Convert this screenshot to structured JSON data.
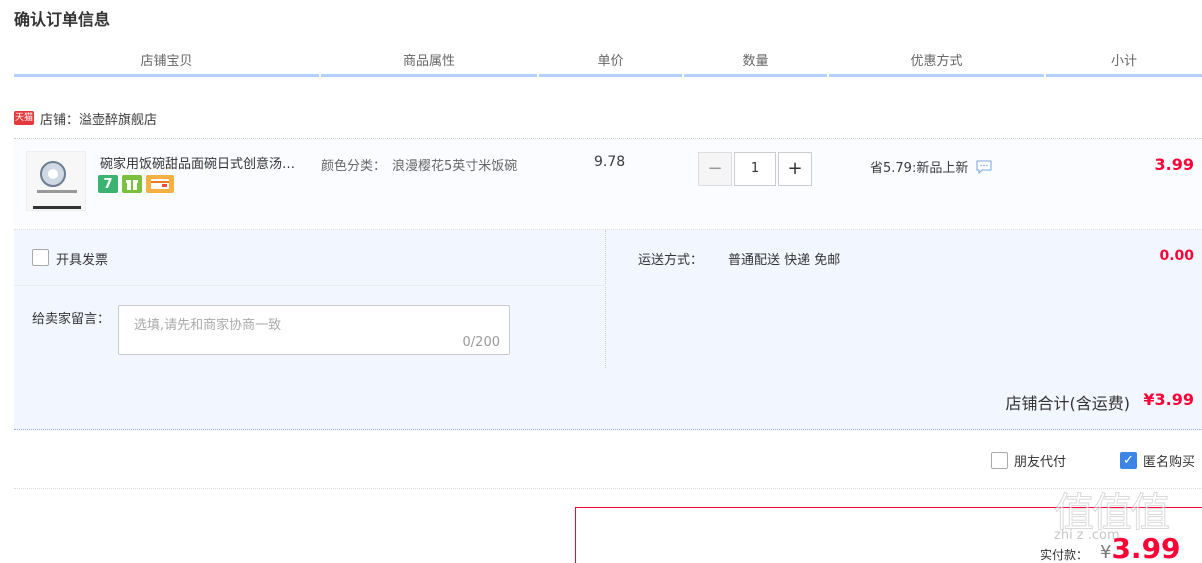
{
  "page": {
    "title": "确认订单信息"
  },
  "columns": [
    "店铺宝贝",
    "商品属性",
    "单价",
    "数量",
    "优惠方式",
    "小计"
  ],
  "shop": {
    "badge": "天猫",
    "label": "店铺：溢壶醉旗舰店"
  },
  "item": {
    "title": "碗家用饭碗甜品面碗日式创意汤…",
    "attr_name": "颜色分类：",
    "attr_value": "浪漫樱花5英寸米饭碗",
    "price": "9.78",
    "quantity": "1",
    "qty_minus": "−",
    "qty_plus": "+",
    "discount": "省5.79:新品上新",
    "subtotal": "3.99",
    "services": [
      "7",
      "gift-icon",
      "card-icon"
    ]
  },
  "invoice": {
    "label": "开具发票"
  },
  "message": {
    "label": "给卖家留言：",
    "placeholder": "选填,请先和商家协商一致",
    "counter": "0/200"
  },
  "shipping": {
    "label": "运送方式：",
    "value": "普通配送 快递 免邮",
    "cost": "0.00"
  },
  "shop_total": {
    "label": "店铺合计(含运费)",
    "amount": "¥3.99"
  },
  "options": {
    "friend_pay": "朋友代付",
    "anonymous": "匿名购买",
    "anonymous_checked": true
  },
  "payment": {
    "label": "实付款：",
    "currency": "¥",
    "amount": "3.99"
  },
  "watermark": {
    "glyphs": "值值值",
    "site": "zhi  z  .com"
  },
  "colors": {
    "accent": "#ff0036",
    "header_line": "#b2d1ff",
    "panel": "#f2f7ff",
    "check": "#3c85e6"
  }
}
